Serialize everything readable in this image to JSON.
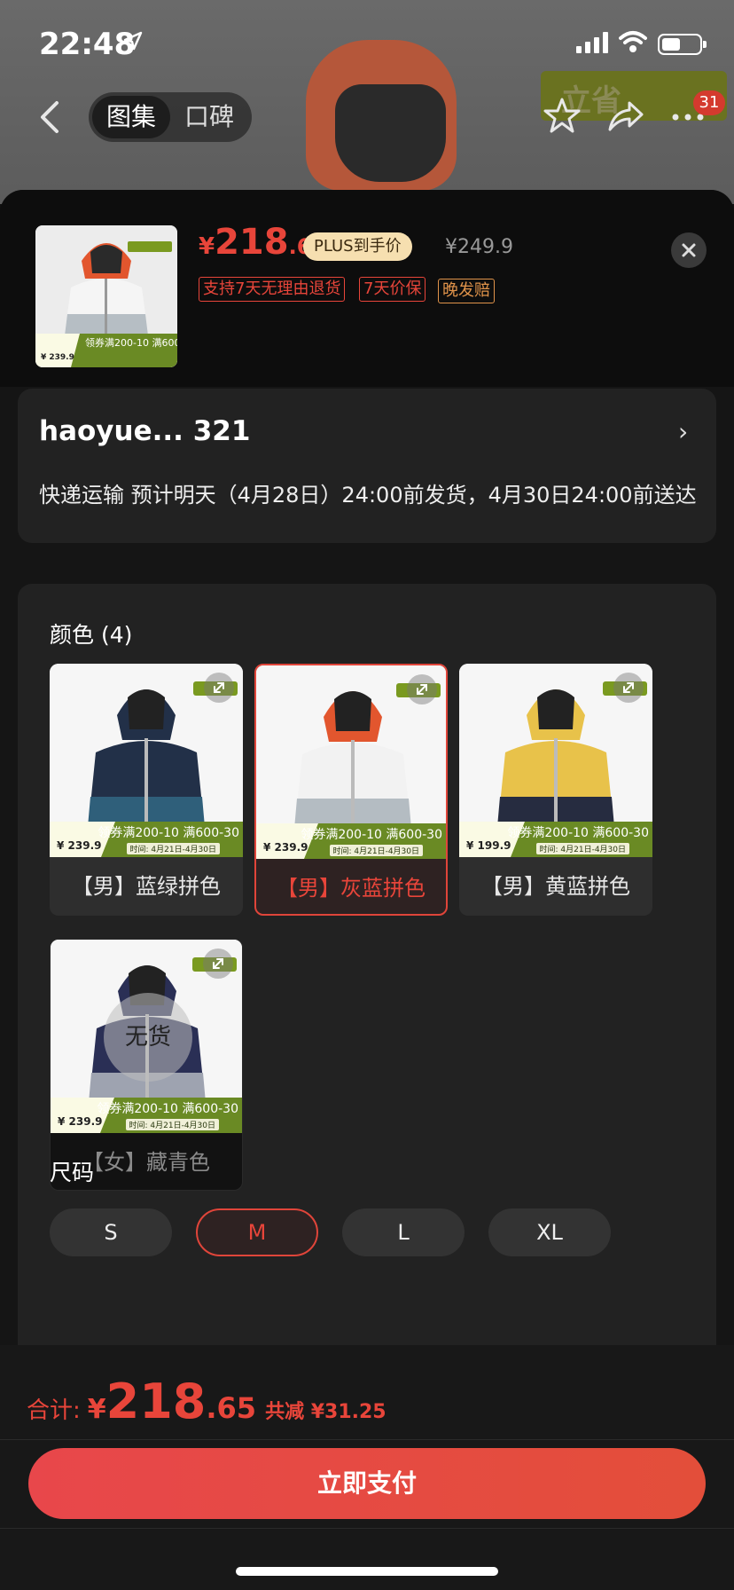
{
  "status_bar": {
    "time": "22:48"
  },
  "nav": {
    "tabs": [
      {
        "label": "图集"
      },
      {
        "label": "口碑"
      }
    ],
    "cart_count": "31",
    "background_badge": "立省"
  },
  "product": {
    "price_currency": "¥",
    "price_integer": "218",
    "price_decimal": ".65",
    "plus_badge": "PLUS到手价",
    "original_price": "¥249.9",
    "tags": [
      {
        "label": "支持7天无理由退货"
      },
      {
        "label": "7天价保"
      },
      {
        "label": "晚发赔"
      }
    ]
  },
  "address": {
    "name": "haoyue...  321",
    "delivery": "快递运输 预计明天（4月28日）24:00前发货，4月30日24:00前送达"
  },
  "colors": {
    "title": "颜色 (4)",
    "no_stock_label": "无货",
    "items": [
      {
        "label": "【男】蓝绿拼色",
        "price": "¥ 239.9",
        "promo": "领券满200-10 满600-30",
        "promo_date": "时间: 4月21日-4月30日",
        "selected": false,
        "available": true,
        "body_color": "#2f5f7a",
        "hood_color": "#223048"
      },
      {
        "label": "【男】灰蓝拼色",
        "price": "¥ 239.9",
        "promo": "领券满200-10 满600-30",
        "promo_date": "时间: 4月21日-4月30日",
        "selected": true,
        "available": true,
        "body_color": "#b4bcc2",
        "hood_color": "#e2562e"
      },
      {
        "label": "【男】黄蓝拼色",
        "price": "¥ 199.9",
        "promo": "领券满200-10 满600-30",
        "promo_date": "时间: 4月21日-4月30日",
        "selected": false,
        "available": true,
        "body_color": "#262c40",
        "hood_color": "#e8c24a"
      },
      {
        "label": "【女】藏青色",
        "price": "¥ 239.9",
        "promo": "领券满200-10 满600-30",
        "promo_date": "时间: 4月21日-4月30日",
        "selected": false,
        "available": false,
        "body_color": "#9ea3b0",
        "hood_color": "#2a2f55"
      }
    ]
  },
  "sizes": {
    "title": "尺码",
    "items": [
      {
        "label": "S",
        "selected": false
      },
      {
        "label": "M",
        "selected": true
      },
      {
        "label": "L",
        "selected": false
      },
      {
        "label": "XL",
        "selected": false
      }
    ]
  },
  "footer": {
    "total_label": "合计:",
    "total_currency": "¥",
    "total_integer": "218",
    "total_decimal": ".65",
    "savings": "共减 ¥31.25",
    "pay_button": "立即支付"
  },
  "colors_theme": {
    "accent": "#e8453a",
    "plus_badge_bg": "#f6dfb0"
  }
}
